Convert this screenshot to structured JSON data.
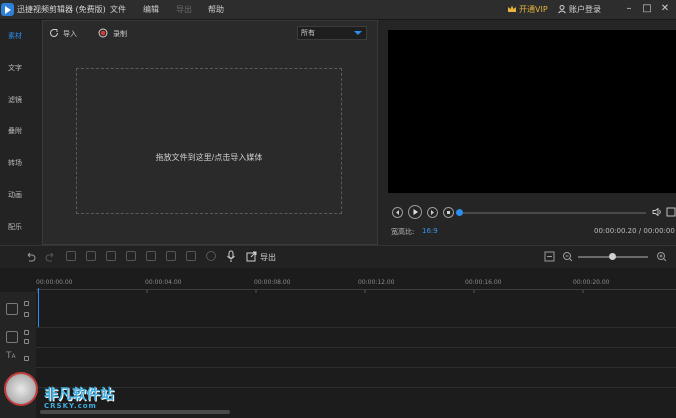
{
  "titlebar": {
    "title": "迅捷视频剪辑器 (免费版)",
    "menus": [
      {
        "label": "文件",
        "enabled": true
      },
      {
        "label": "编辑",
        "enabled": true
      },
      {
        "label": "导出",
        "enabled": false
      },
      {
        "label": "帮助",
        "enabled": true
      }
    ],
    "vip_label": "开通VIP",
    "account_label": "账户登录"
  },
  "leftnav": {
    "items": [
      {
        "label": "素材",
        "active": true
      },
      {
        "label": "文字",
        "active": false
      },
      {
        "label": "滤镜",
        "active": false
      },
      {
        "label": "叠附",
        "active": false
      },
      {
        "label": "转场",
        "active": false
      },
      {
        "label": "动画",
        "active": false
      },
      {
        "label": "配乐",
        "active": false
      }
    ]
  },
  "media": {
    "import_label": "导入",
    "record_label": "录制",
    "filter_value": "所有",
    "dropzone_text": "拖放文件到这里/点击导入媒体"
  },
  "preview": {
    "ratio_label": "宽高比:",
    "ratio_value": "16:9",
    "time_display": "00:00:00.20 / 00:00:00"
  },
  "toolbar": {
    "export_label": "导出"
  },
  "timeline": {
    "ruler_labels": [
      "00:00:00.00",
      "00:00:04.00",
      "00:00:08.00",
      "00:00:12.00",
      "00:00:16.00",
      "00:00:20.00"
    ]
  },
  "watermark": {
    "text": "非凡软件站",
    "subtext": "CRSKY.com"
  },
  "colors": {
    "accent": "#2b8df0",
    "background": "#1f1f1f",
    "preview": "#000000"
  }
}
